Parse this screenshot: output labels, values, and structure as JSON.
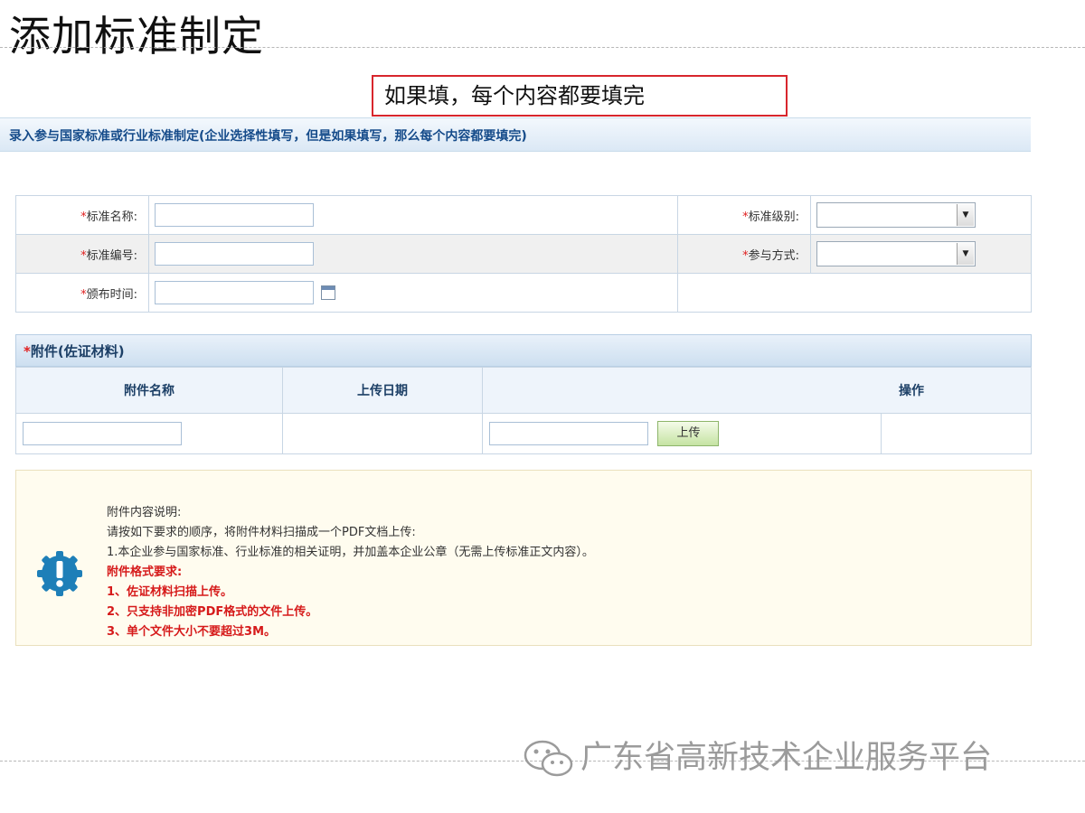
{
  "slide": {
    "title": "添加标准制定"
  },
  "callout": {
    "text": "如果填，每个内容都要填完"
  },
  "page": {
    "header": "录入参与国家标准或行业标准制定(企业选择性填写，但是如果填写，那么每个内容都要填完)"
  },
  "form": {
    "required_mark": "*",
    "name_label": "标准名称:",
    "level_label": "标准级别:",
    "number_label": "标准编号:",
    "participation_label": "参与方式:",
    "date_label": "颁布时间:",
    "name_value": "",
    "number_value": "",
    "date_value": ""
  },
  "attachments": {
    "required_mark": "*",
    "title": "附件(佐证材料)",
    "columns": [
      "附件名称",
      "上传日期",
      "操作"
    ],
    "upload_button": "上传"
  },
  "notice": {
    "heading": "附件内容说明:",
    "instruction": "请按如下要求的顺序，将附件材料扫描成一个PDF文档上传:",
    "item1": "1.本企业参与国家标准、行业标准的相关证明，并加盖本企业公章（无需上传标准正文内容）。",
    "format_heading": "附件格式要求:",
    "rules": [
      "1、佐证材料扫描上传。",
      "2、只支持非加密PDF格式的文件上传。",
      "3、单个文件大小不要超过3M。"
    ]
  },
  "watermark": {
    "text": "广东省高新技术企业服务平台"
  },
  "colors": {
    "callout_border": "#d8262d",
    "header_text": "#154b8a",
    "required": "#e02020",
    "notice_red": "#d61a1a",
    "notice_bg": "#fffcef",
    "icon_blue": "#1e7fb8"
  },
  "icons": {
    "calendar": "calendar-icon",
    "dropdown": "chevron-down-icon",
    "notice": "exclamation-gear-icon",
    "watermark": "wechat-icon"
  }
}
